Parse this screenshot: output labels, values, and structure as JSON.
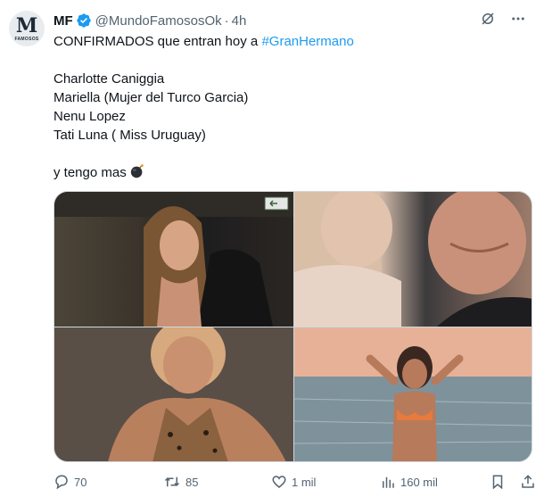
{
  "author": {
    "name": "MF",
    "handle": "@MundoFamososOk",
    "separator": "·",
    "time": "4h",
    "avatar": {
      "letter": "M",
      "subtext": "FAMOSOS"
    }
  },
  "tweet": {
    "line1_text": "CONFIRMADOS que entran hoy a ",
    "hashtag": "#GranHermano",
    "names": [
      "Charlotte Caniggia",
      "Mariella (Mujer del Turco Garcia)",
      "Nenu Lopez",
      "Tati Luna ( Miss Uruguay)"
    ],
    "closing": "y tengo mas",
    "emoji_icon": "bomb-icon"
  },
  "media": {
    "photos": [
      {
        "icon": "photo-woman-selfie"
      },
      {
        "icon": "photo-couple-selfie"
      },
      {
        "icon": "photo-woman-leopard"
      },
      {
        "icon": "photo-woman-beach"
      }
    ]
  },
  "actions": {
    "replies": "70",
    "reposts": "85",
    "likes": "1 mil",
    "views": "160 mil"
  },
  "colors": {
    "link": "#1d9bf0",
    "secondary": "#536471",
    "verified": "#1d9bf0",
    "text": "#0f1419"
  }
}
